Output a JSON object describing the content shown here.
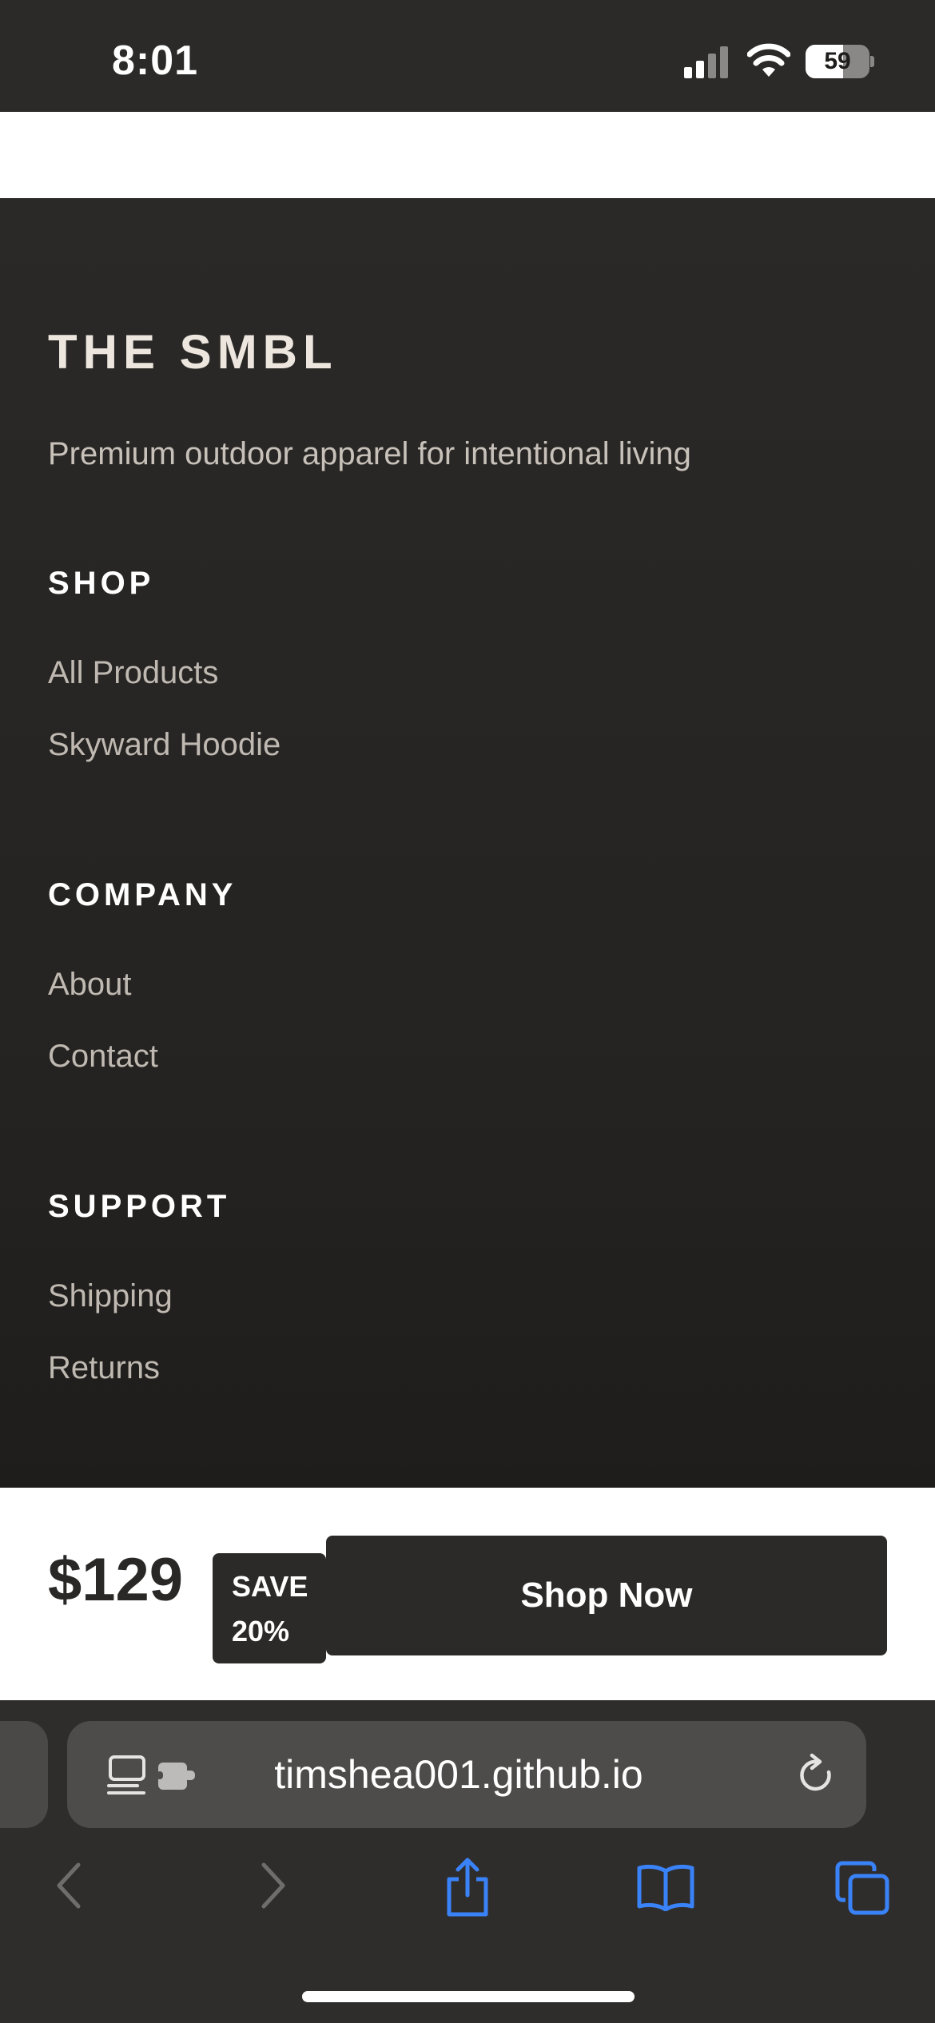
{
  "status_bar": {
    "time": "8:01",
    "battery_percent": "59",
    "battery_level": 0.59
  },
  "footer": {
    "brand": "THE SMBL",
    "tagline": "Premium outdoor apparel for intentional living",
    "sections": [
      {
        "title": "SHOP",
        "links": [
          "All Products",
          "Skyward Hoodie"
        ]
      },
      {
        "title": "COMPANY",
        "links": [
          "About",
          "Contact"
        ]
      },
      {
        "title": "SUPPORT",
        "links": [
          "Shipping",
          "Returns"
        ]
      }
    ]
  },
  "sticky_bar": {
    "price": "$129",
    "save_line1": "SAVE",
    "save_line2": "20%",
    "cta_label": "Shop Now"
  },
  "browser": {
    "url": "timshea001.github.io"
  },
  "colors": {
    "dark": "#2c2a28",
    "accent_blue": "#3a82f7",
    "light_text": "#ece6df"
  },
  "icons": [
    "signal-icon",
    "wifi-icon",
    "battery-icon",
    "reader-mode-icon",
    "extension-icon",
    "reload-icon",
    "back-icon",
    "forward-icon",
    "share-icon",
    "bookmarks-icon",
    "tabs-icon"
  ]
}
